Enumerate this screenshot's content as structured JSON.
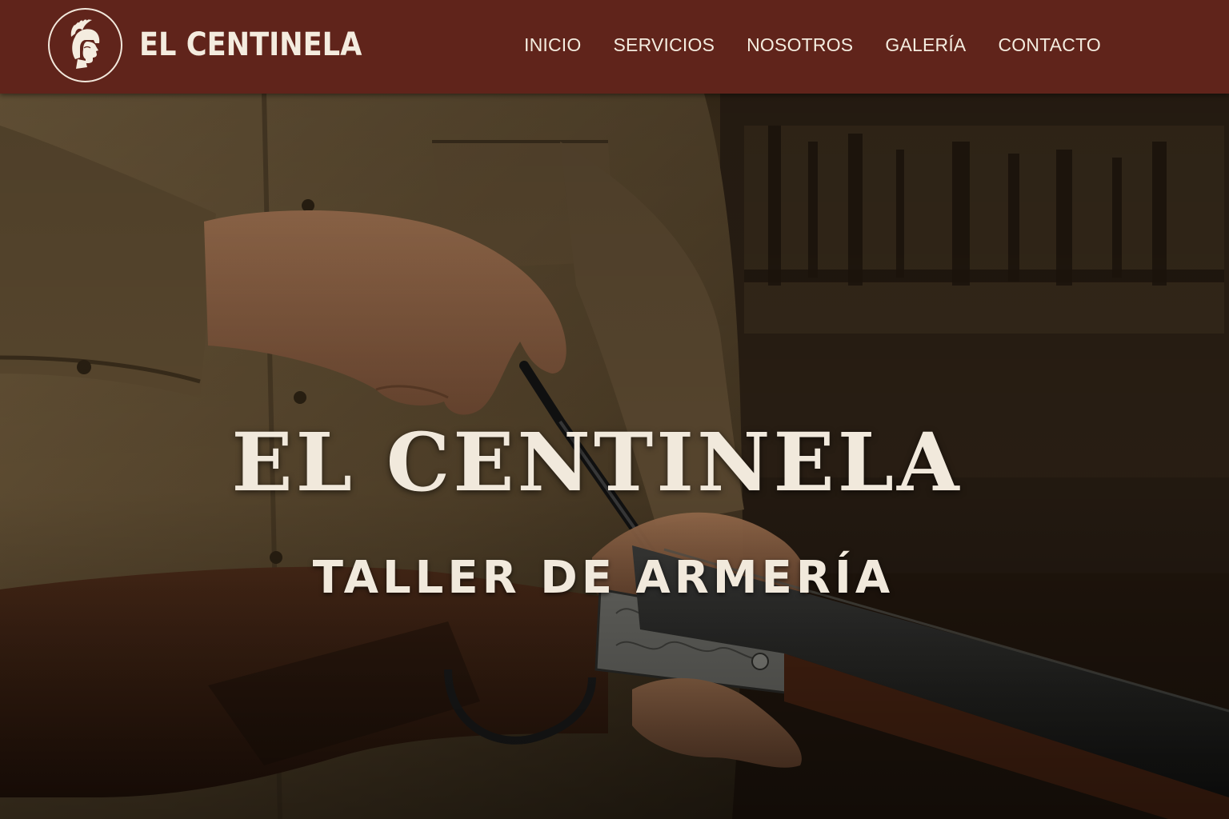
{
  "header": {
    "brand_name": "EL CENTINELA",
    "logo_icon": "helmeted-warrior-profile-icon",
    "nav": [
      {
        "label": "INICIO"
      },
      {
        "label": "SERVICIOS"
      },
      {
        "label": "NOSOTROS"
      },
      {
        "label": "GALERÍA"
      },
      {
        "label": "CONTACTO"
      }
    ]
  },
  "hero": {
    "title": "EL CENTINELA",
    "subtitle": "TALLER DE ARMERÍA",
    "image": "gunsmith-working-on-shotgun-photo"
  },
  "colors": {
    "header_bg": "#60241b",
    "text_light": "#f1e9dc",
    "hero_dark": "#1e140b"
  }
}
